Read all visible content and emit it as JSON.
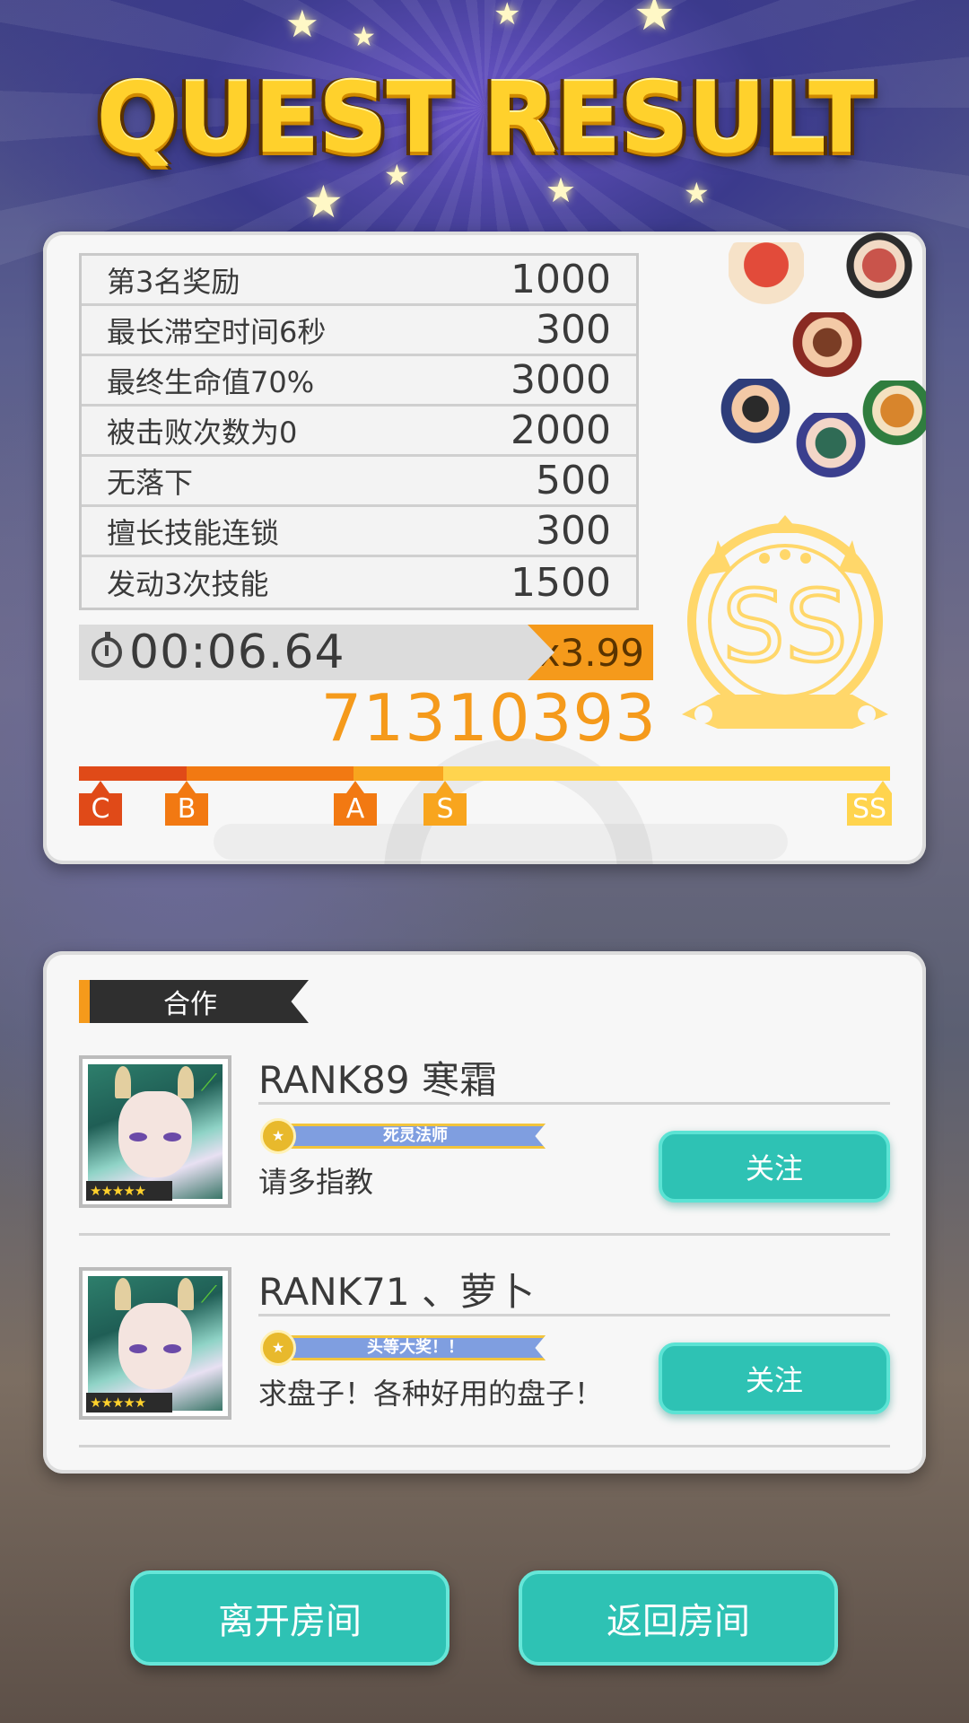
{
  "header": {
    "title": "QUEST RESULT"
  },
  "bonuses": [
    {
      "label": "第3名奖励",
      "value": "1000"
    },
    {
      "label": "最长滞空时间6秒",
      "value": "300"
    },
    {
      "label": "最终生命值70%",
      "value": "3000"
    },
    {
      "label": "被击败次数为0",
      "value": "2000"
    },
    {
      "label": "无落下",
      "value": "500"
    },
    {
      "label": "擅长技能连锁",
      "value": "300"
    },
    {
      "label": "发动3次技能",
      "value": "1500"
    }
  ],
  "timer": {
    "time": "00:06.64",
    "multiplier": "x3.99"
  },
  "score": {
    "total": "71310393",
    "rank": "SS"
  },
  "rank_scale": {
    "marks": [
      "C",
      "B",
      "A",
      "S",
      "SS"
    ],
    "progress": 1.0
  },
  "coop": {
    "section_title": "合作",
    "players": [
      {
        "name": "RANK89 寒霜",
        "title_badge": "死灵法师",
        "message": "请多指教",
        "follow_label": "关注",
        "stars": "★★★★★"
      },
      {
        "name": "RANK71 、萝卜",
        "title_badge": "头等大奖！！",
        "message": "求盘子！各种好用的盘子！",
        "follow_label": "关注",
        "stars": "★★★★★"
      }
    ]
  },
  "footer": {
    "leave_label": "离开房间",
    "return_label": "返回房间"
  },
  "colors": {
    "accent_orange": "#f59a1b",
    "teal_button": "#2ec2b4",
    "gold": "#ffd12c"
  }
}
